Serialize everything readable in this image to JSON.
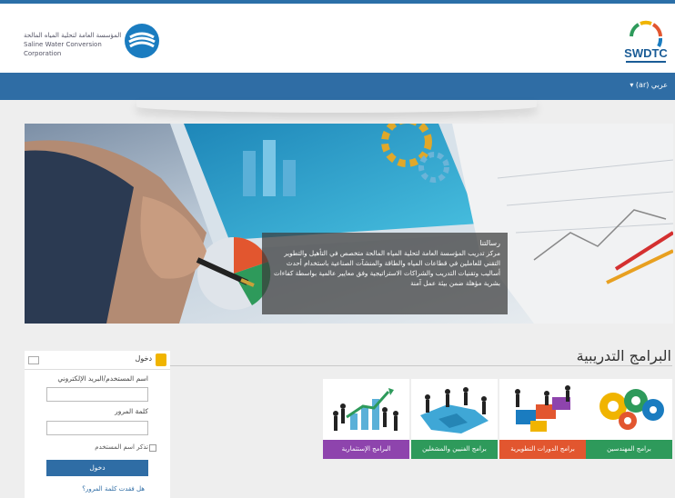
{
  "header": {
    "org_name_ar": "المؤسسة العامة لتحلية المياه المالحة",
    "org_name_en": "Saline Water Conversion Corporation",
    "brand": "SWDTC"
  },
  "nav": {
    "language": "عربي (ar) ▾"
  },
  "banner": {
    "caption_title": "رسالتنا",
    "caption_text": "مركز تدريب المؤسسة العامة لتحلية المياه المالحة متخصص في التأهيل والتطوير التقني للعاملين في قطاعات المياه والطاقة والمنشآت الصناعية باستخدام أحدث أساليب وتقنيات التدريب والشراكات الاستراتيجية وفق معايير عالمية بواسطة كفاءات بشرية مؤهلة ضمن بيئة عمل آمنة"
  },
  "programs": {
    "title": "البرامج التدريبية",
    "cards": [
      {
        "label": "برامج المهندسين",
        "color": "#2e9a5b"
      },
      {
        "label": "برامج الدورات التطويرية",
        "color": "#e2562f"
      },
      {
        "label": "برامج الفنيين والمشغلين",
        "color": "#2e9a5b"
      },
      {
        "label": "البرامج الإستثمارية",
        "color": "#8e44ad"
      }
    ]
  },
  "login": {
    "title": "دخول",
    "username_label": "اسم المستخدم/البريد الإلكتروني",
    "password_label": "كلمة المرور",
    "remember_label": "تذكر اسم المستخدم",
    "button_label": "دخول",
    "forgot_label": "هل فقدت كلمة المرور؟"
  }
}
